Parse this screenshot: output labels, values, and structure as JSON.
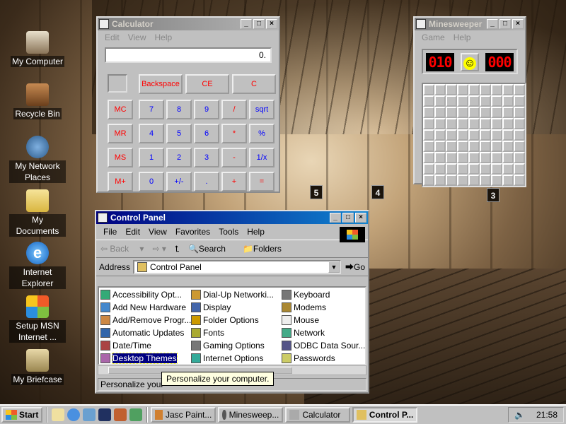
{
  "desktop": {
    "icons": [
      {
        "label": "My Computer",
        "icon": "computer-icon"
      },
      {
        "label": "Recycle Bin",
        "icon": "recycle-bin-icon"
      },
      {
        "label": "My Network Places",
        "icon": "network-icon"
      },
      {
        "label": "My Documents",
        "icon": "folder-icon"
      },
      {
        "label": "Internet Explorer",
        "icon": "ie-icon"
      },
      {
        "label": "Setup MSN Internet ...",
        "icon": "msn-icon"
      },
      {
        "label": "My Briefcase",
        "icon": "briefcase-icon"
      }
    ],
    "platform_signs": [
      "5",
      "4",
      "3"
    ]
  },
  "calculator": {
    "title": "Calculator",
    "menu": [
      "Edit",
      "View",
      "Help"
    ],
    "display": "0.",
    "controls": [
      "Backspace",
      "CE",
      "C"
    ],
    "memory": [
      "MC",
      "MR",
      "MS",
      "M+"
    ],
    "keys": [
      [
        "7",
        "8",
        "9",
        "/",
        "sqrt"
      ],
      [
        "4",
        "5",
        "6",
        "*",
        "%"
      ],
      [
        "1",
        "2",
        "3",
        "-",
        "1/x"
      ],
      [
        "0",
        "+/-",
        ".",
        "+",
        "="
      ]
    ]
  },
  "minesweeper": {
    "title": "Minesweeper",
    "menu": [
      "Game",
      "Help"
    ],
    "mines": "010",
    "timer": "000",
    "face": "☺",
    "rows": 9,
    "cols": 9
  },
  "controlpanel": {
    "title": "Control Panel",
    "menu": [
      "File",
      "Edit",
      "View",
      "Favorites",
      "Tools",
      "Help"
    ],
    "toolbar": {
      "back": "Back",
      "search": "Search",
      "folders": "Folders"
    },
    "address_label": "Address",
    "address_value": "Control Panel",
    "go": "Go",
    "items": [
      "Accessibility Opt...",
      "Add New Hardware",
      "Add/Remove Progr...",
      "Automatic Updates",
      "Date/Time",
      "Desktop Themes",
      "Dial-Up Networki...",
      "Display",
      "Folder Options",
      "Fonts",
      "Gaming Options",
      "Internet Options",
      "Keyboard",
      "Modems",
      "Mouse",
      "Network",
      "ODBC Data Sour...",
      "Passwords"
    ],
    "selected": "Desktop Themes",
    "status": "Personalize your",
    "tooltip": "Personalize your computer."
  },
  "taskbar": {
    "start": "Start",
    "tasks": [
      "Jasc Paint...",
      "Minesweep...",
      "Calculator",
      "Control P..."
    ],
    "active_task": "Control P...",
    "clock": "21:58"
  },
  "colors": {
    "titlebar": "#000080",
    "face": "#c0c0c0",
    "lcd": "#ff0000"
  }
}
